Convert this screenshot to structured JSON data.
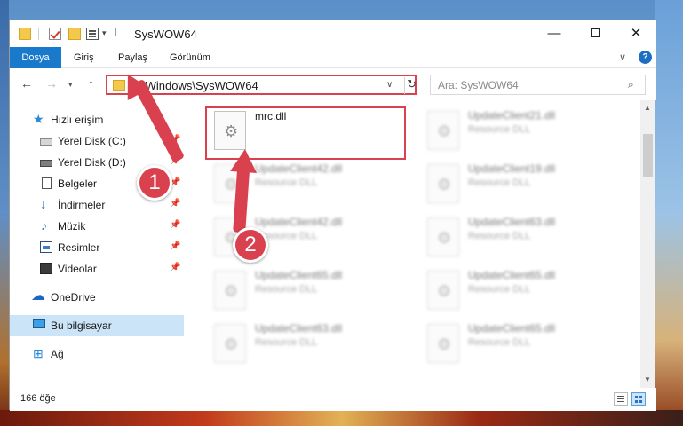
{
  "window": {
    "title": "SysWOW64"
  },
  "ribbon": {
    "tabs": [
      "Dosya",
      "Giriş",
      "Paylaş",
      "Görünüm"
    ],
    "help": "?"
  },
  "nav": {
    "address": "C:\\Windows\\SysWOW64",
    "search_placeholder": "Ara: SysWOW64"
  },
  "sidebar": {
    "items": [
      {
        "label": "Hızlı erişim",
        "icon": "star-icon",
        "pinned": false
      },
      {
        "label": "Yerel Disk (C:)",
        "icon": "drive-icon",
        "pinned": true
      },
      {
        "label": "Yerel Disk (D:)",
        "icon": "drive-icon",
        "pinned": true
      },
      {
        "label": "Belgeler",
        "icon": "documents-icon",
        "pinned": true
      },
      {
        "label": "İndirmeler",
        "icon": "download-icon",
        "pinned": true
      },
      {
        "label": "Müzik",
        "icon": "music-icon",
        "pinned": true
      },
      {
        "label": "Resimler",
        "icon": "pictures-icon",
        "pinned": true
      },
      {
        "label": "Videolar",
        "icon": "video-icon",
        "pinned": true
      },
      {
        "label": "OneDrive",
        "icon": "cloud-icon",
        "pinned": false
      },
      {
        "label": "Bu bilgisayar",
        "icon": "computer-icon",
        "pinned": false,
        "selected": true
      },
      {
        "label": "Ağ",
        "icon": "network-icon",
        "pinned": false
      }
    ]
  },
  "files": [
    {
      "name": "mrc.dll",
      "type": "",
      "highlighted": true
    },
    {
      "name": "UpdateClient21.dll",
      "type": "Resource DLL"
    },
    {
      "name": "UpdateClient42.dll",
      "type": "Resource DLL"
    },
    {
      "name": "UpdateClient19.dll",
      "type": "Resource DLL"
    },
    {
      "name": "UpdateClient42.dll",
      "type": "Resource DLL"
    },
    {
      "name": "UpdateClient63.dll",
      "type": "Resource DLL"
    },
    {
      "name": "UpdateClient65.dll",
      "type": "Resource DLL"
    },
    {
      "name": "UpdateClient65.dll",
      "type": "Resource DLL"
    },
    {
      "name": "UpdateClient63.dll",
      "type": "Resource DLL"
    },
    {
      "name": "UpdateClient65.dll",
      "type": "Resource DLL"
    }
  ],
  "status": {
    "count": "166 öğe"
  },
  "callouts": {
    "one": "1",
    "two": "2"
  },
  "colors": {
    "accent": "#1979ca",
    "highlight_red": "#d9414e",
    "selected_bg": "#cce4f7"
  }
}
